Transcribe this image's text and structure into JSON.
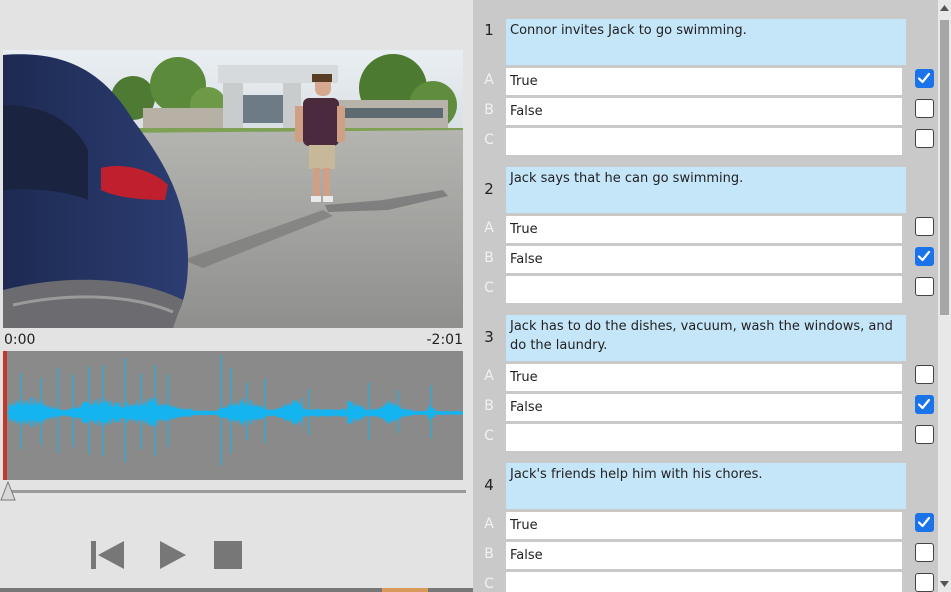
{
  "player": {
    "time_elapsed": "0:00",
    "time_remaining": "-2:01",
    "progress": 0,
    "playhead_color": "#c0392b",
    "waveform_color": "#14b4f0",
    "controls": {
      "prev_icon": "skip-back-icon",
      "play_icon": "play-icon",
      "stop_icon": "stop-icon"
    }
  },
  "quiz": {
    "accent_color": "#1a73e8",
    "question_bg": "#c5e5f8",
    "questions": [
      {
        "number": "1",
        "text": "Connor invites Jack to go swimming.",
        "options": [
          {
            "letter": "A",
            "value": "True",
            "checked": true
          },
          {
            "letter": "B",
            "value": "False",
            "checked": false
          },
          {
            "letter": "C",
            "value": "",
            "checked": false
          }
        ]
      },
      {
        "number": "2",
        "text": "Jack says that he can go swimming.",
        "options": [
          {
            "letter": "A",
            "value": "True",
            "checked": false
          },
          {
            "letter": "B",
            "value": "False",
            "checked": true
          },
          {
            "letter": "C",
            "value": "",
            "checked": false
          }
        ]
      },
      {
        "number": "3",
        "text": "Jack has to do the dishes, vacuum, wash the windows, and do the laundry.",
        "options": [
          {
            "letter": "A",
            "value": "True",
            "checked": false
          },
          {
            "letter": "B",
            "value": "False",
            "checked": true
          },
          {
            "letter": "C",
            "value": "",
            "checked": false
          }
        ]
      },
      {
        "number": "4",
        "text": "Jack's friends help him with his chores.",
        "options": [
          {
            "letter": "A",
            "value": "True",
            "checked": true
          },
          {
            "letter": "B",
            "value": "False",
            "checked": false
          },
          {
            "letter": "C",
            "value": "",
            "checked": false
          }
        ]
      }
    ]
  }
}
